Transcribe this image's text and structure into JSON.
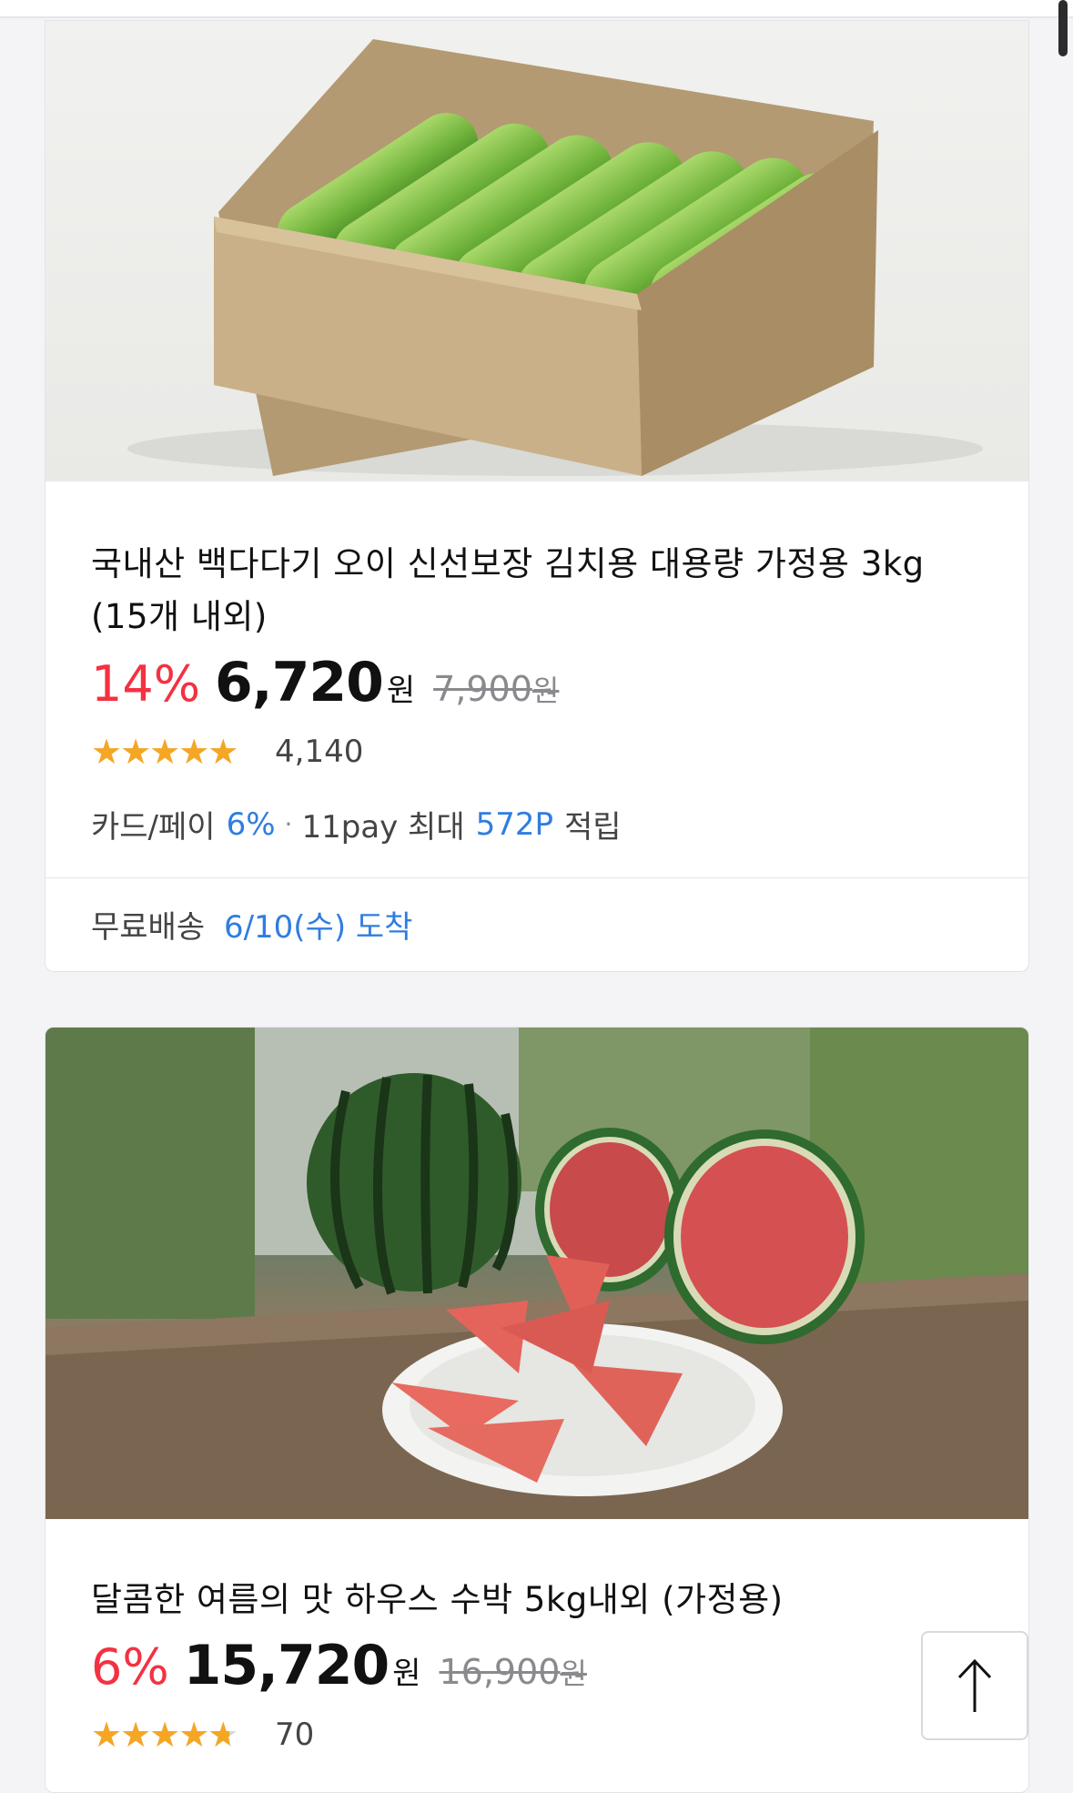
{
  "products": [
    {
      "image_alt": "cucumbers in cardboard box",
      "title": "국내산 백다다기 오이 신선보장 김치용 대용량 가정용 3kg (15개 내외)",
      "discount": "14%",
      "price": "6,720",
      "currency": "원",
      "original_price": "7,900",
      "original_currency": "원",
      "rating": 4.5,
      "rating_max": 5,
      "review_count": "4,140",
      "benefit": {
        "label": "카드/페이",
        "card_rate": "6%",
        "pay_label": "11pay 최대",
        "points": "572P",
        "suffix": "적립"
      },
      "shipping": {
        "label": "무료배송",
        "arrival": "6/10(수) 도착"
      }
    },
    {
      "image_alt": "watermelon with slices on plate",
      "title": "달콤한 여름의 맛 하우스 수박 5kg내외 (가정용)",
      "discount": "6%",
      "price": "15,720",
      "currency": "원",
      "original_price": "16,900",
      "original_currency": "원",
      "rating": 4,
      "rating_max": 5,
      "review_count": "70"
    }
  ],
  "scroll_top_icon": "arrow-up-icon"
}
